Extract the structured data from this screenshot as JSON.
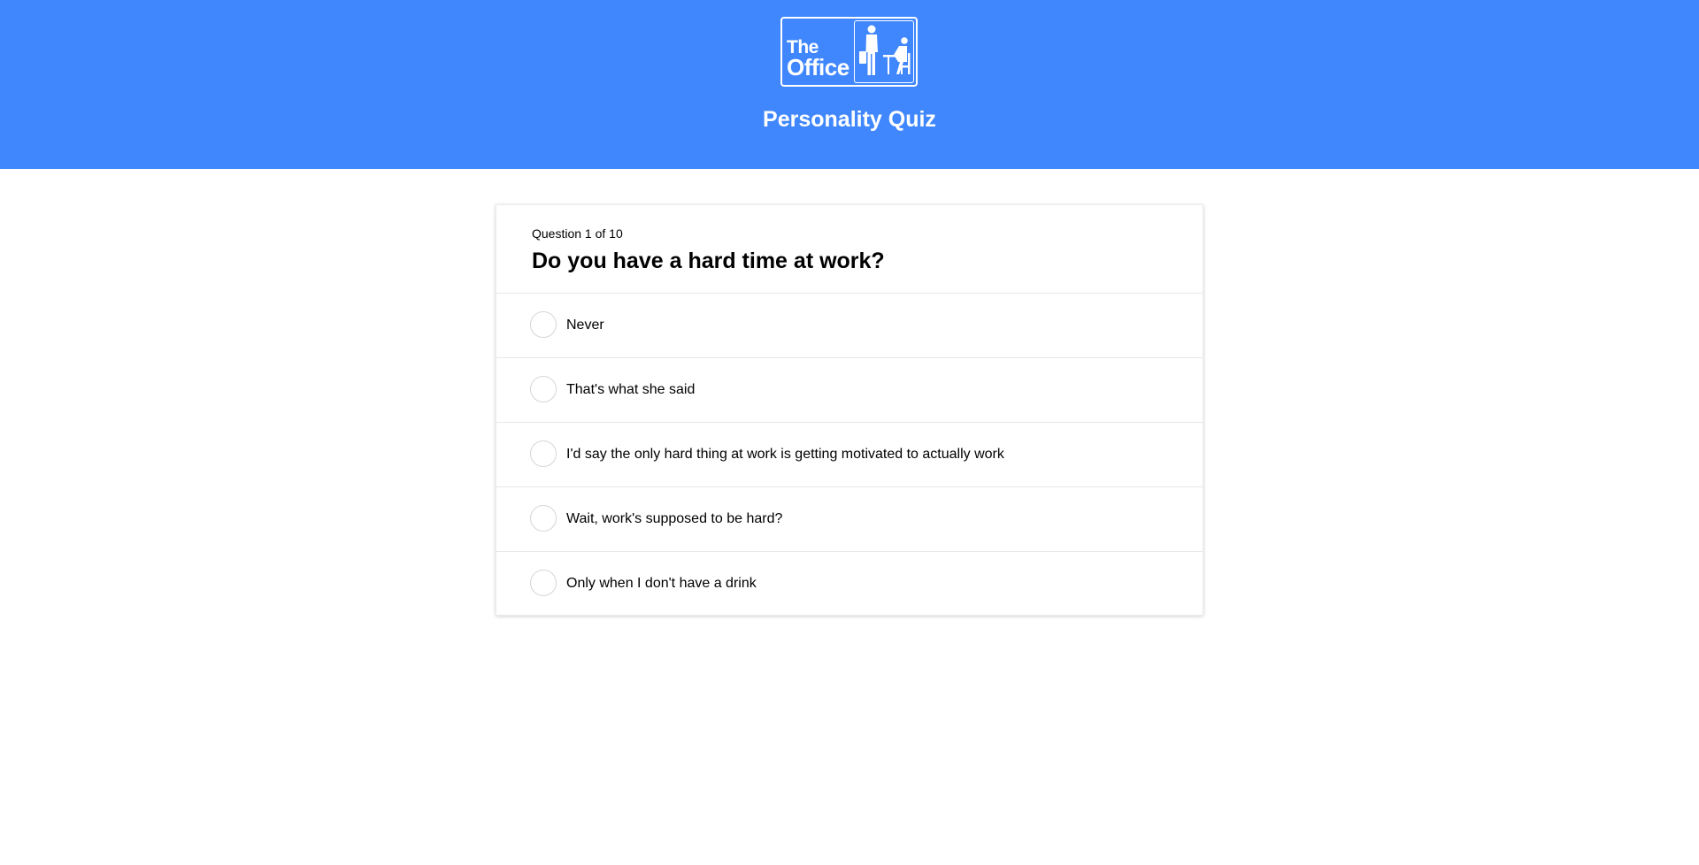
{
  "header": {
    "logo": {
      "line1": "The",
      "line2": "Office"
    },
    "title": "Personality Quiz"
  },
  "quiz": {
    "counter": "Question 1 of 10",
    "question": "Do you have a hard time at work?",
    "answers": [
      {
        "label": "Never"
      },
      {
        "label": "That's what she said"
      },
      {
        "label": "I'd say the only hard thing at work is getting motivated to actually work"
      },
      {
        "label": "Wait, work's supposed to be hard?"
      },
      {
        "label": "Only when I don't have a drink"
      }
    ]
  },
  "colors": {
    "header_background": "#4087fe",
    "header_text": "#ffffff",
    "radio_border": "#d6d6d6"
  },
  "icons": {
    "logo_illustration": "office-workers-icon"
  }
}
